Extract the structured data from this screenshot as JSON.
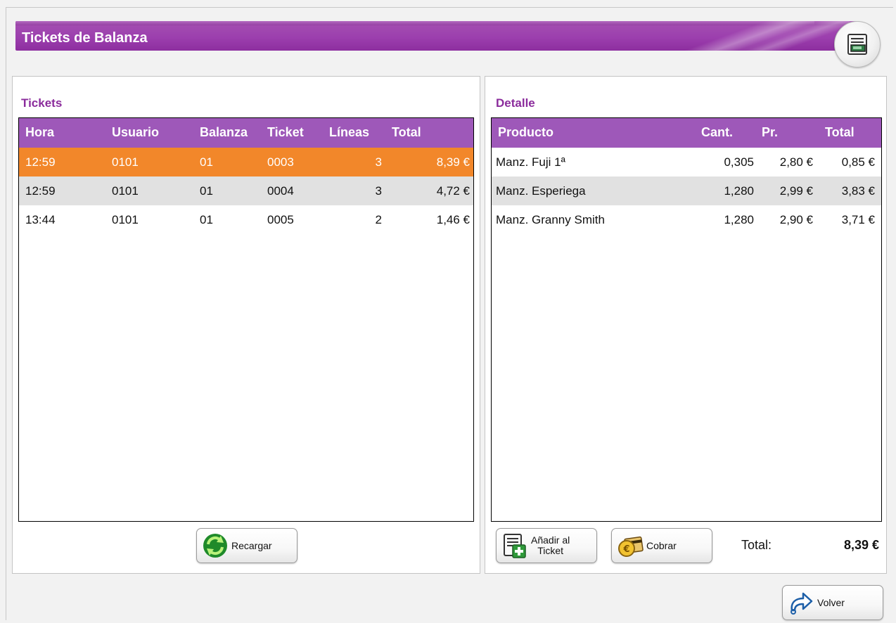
{
  "title": "Tickets de Balanza",
  "tickets": {
    "title": "Tickets",
    "columns": [
      "Hora",
      "Usuario",
      "Balanza",
      "Ticket",
      "Líneas",
      "Total"
    ],
    "rows": [
      {
        "hora": "12:59",
        "usuario": "0101",
        "balanza": "01",
        "ticket": "0003",
        "lineas": "3",
        "total": "8,39 €",
        "state": "selected"
      },
      {
        "hora": "12:59",
        "usuario": "0101",
        "balanza": "01",
        "ticket": "0004",
        "lineas": "3",
        "total": "4,72 €",
        "state": "alternate"
      },
      {
        "hora": "13:44",
        "usuario": "0101",
        "balanza": "01",
        "ticket": "0005",
        "lineas": "2",
        "total": "1,46 €",
        "state": "normal"
      }
    ],
    "reload_label": "Recargar"
  },
  "detail": {
    "title": "Detalle",
    "columns": [
      "Producto",
      "Cant.",
      "Pr.",
      "Total"
    ],
    "rows": [
      {
        "producto": "Manz. Fuji 1ª",
        "cant": "0,305",
        "pr": "2,80 €",
        "total": "0,85 €"
      },
      {
        "producto": "Manz. Esperiega",
        "cant": "1,280",
        "pr": "2,99 €",
        "total": "3,83 €"
      },
      {
        "producto": "Manz. Granny Smith",
        "cant": "1,280",
        "pr": "2,90 €",
        "total": "3,71 €"
      }
    ],
    "add_label_line1": "Añadir al",
    "add_label_line2": "Ticket",
    "charge_label": "Cobrar",
    "total_label": "Total:",
    "total_value": "8,39 €"
  },
  "back_label": "Volver",
  "colors": {
    "accent_purple": "#9e58b9",
    "title_purple": "#8b2c9c",
    "selected_row": "#f2872a",
    "alternate_row": "#e1e1e1"
  },
  "icons": {
    "title": "scale-ticket-icon",
    "reload": "reload-arrows-icon",
    "add": "add-to-ticket-icon",
    "charge": "coin-card-icon",
    "back": "back-arrow-icon"
  }
}
